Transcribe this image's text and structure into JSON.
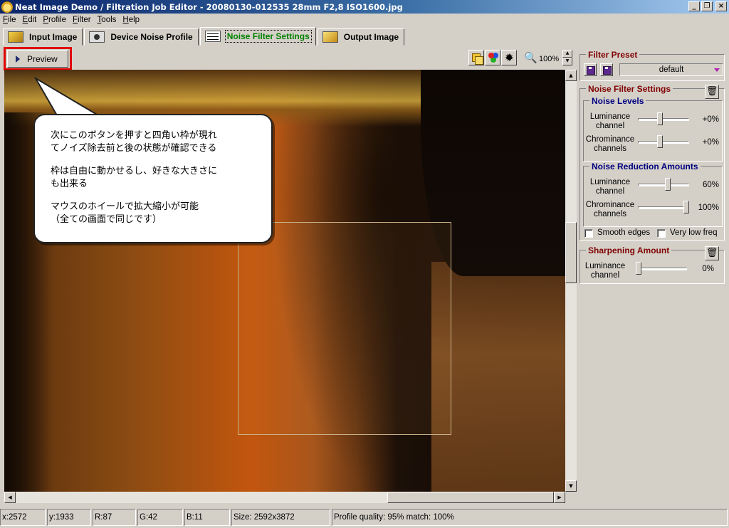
{
  "window": {
    "title": "Neat Image Demo / Filtration Job Editor - 20080130-012535 28mm F2,8 ISO1600.jpg",
    "buttons": [
      "_",
      "❐",
      "×"
    ]
  },
  "menu": [
    "File",
    "Edit",
    "Profile",
    "Filter",
    "Tools",
    "Help"
  ],
  "tabs": [
    {
      "label": "Input Image",
      "icon": "input-image-icon"
    },
    {
      "label": "Device Noise Profile",
      "icon": "camera-icon"
    },
    {
      "label": "Noise Filter Settings",
      "icon": "sliders-icon",
      "active": true
    },
    {
      "label": "Output Image",
      "icon": "output-image-icon"
    }
  ],
  "toolbar": {
    "preview_label": "Preview",
    "zoom": "100%"
  },
  "callout": {
    "paragraph1": "次にこのボタンを押すと四角い枠が現れ\nてノイズ除去前と後の状態が確認できる",
    "paragraph2": "枠は自由に動かせるし、好きな大きさに\nも出来る",
    "paragraph3": "マウスのホイールで拡大縮小が可能\n（全ての画面で同じです）"
  },
  "filter_preset": {
    "title": "Filter Preset",
    "selected": "default"
  },
  "noise_filter": {
    "title": "Noise Filter Settings",
    "noise_levels": {
      "title": "Noise Levels",
      "rows": [
        {
          "label": "Luminance\nchannel",
          "value": "+0%",
          "level": 0.42
        },
        {
          "label": "Chrominance\nchannels",
          "value": "+0%",
          "level": 0.42
        }
      ]
    },
    "reduction": {
      "title": "Noise Reduction Amounts",
      "rows": [
        {
          "label": "Luminance\nchannel",
          "value": "60%",
          "level": 0.6
        },
        {
          "label": "Chrominance\nchannels",
          "value": "100%",
          "level": 1.0
        }
      ]
    },
    "smooth_edges": "Smooth edges",
    "very_low_freq": "Very low freq"
  },
  "sharpening": {
    "title": "Sharpening Amount",
    "rows": [
      {
        "label": "Luminance\nchannel",
        "value": "0%",
        "level": 0.0
      }
    ]
  },
  "status": {
    "x": "x:2572",
    "y": "y:1933",
    "r": "R:87",
    "g": "G:42",
    "b": "B:11",
    "size": "Size: 2592x3872",
    "profile": "Profile quality: 95%  match: 100%"
  }
}
